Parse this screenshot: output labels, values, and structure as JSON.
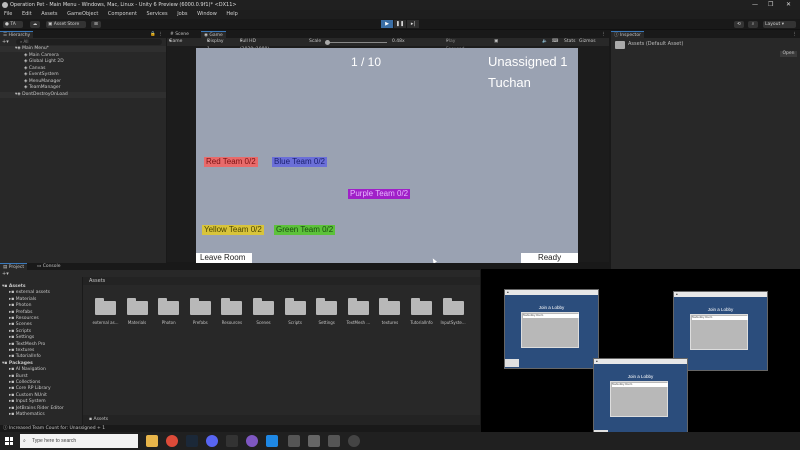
{
  "window": {
    "title": "Operation Pet - Main Menu - Windows, Mac, Linux - Unity 6 Preview (6000.0.9f1)* <DX11>",
    "controls": [
      "—",
      "❐",
      "✕"
    ]
  },
  "menu": [
    "File",
    "Edit",
    "Assets",
    "GameObject",
    "Component",
    "Services",
    "Jobs",
    "Window",
    "Help"
  ],
  "toolbar": {
    "account": "TA",
    "asset_store": "Asset Store",
    "layout": "Layout"
  },
  "hierarchy": {
    "tab": "Hierarchy",
    "search_placeholder": "All",
    "rows": [
      {
        "label": "Main Menu*",
        "indent": 0,
        "scene": true
      },
      {
        "label": "Main Camera",
        "indent": 1
      },
      {
        "label": "Global Light 2D",
        "indent": 1
      },
      {
        "label": "Canvas",
        "indent": 1
      },
      {
        "label": "EventSystem",
        "indent": 1
      },
      {
        "label": "MenuManager",
        "indent": 1
      },
      {
        "label": "TeamManager",
        "indent": 1
      },
      {
        "label": "DontDestroyOnLoad",
        "indent": 0,
        "scene": true
      }
    ]
  },
  "game": {
    "tabs": [
      "Scene",
      "Game"
    ],
    "display_mode": "Game",
    "display": "Display 1",
    "resolution": "Full HD (1920x1080)",
    "scale_label": "Scale",
    "scale_value": "0.48x",
    "play_mode": "Play Focused",
    "stats": "Stats",
    "gizmos": "Gizmos",
    "ui": {
      "counter": "1 / 10",
      "unassigned": "Unassigned 1",
      "player_name": "Tuchan",
      "teams": [
        {
          "label": "Red Team 0/2",
          "color": "#e86a6a",
          "text_color": "#7a1111"
        },
        {
          "label": "Blue Team 0/2",
          "color": "#6b6fd8",
          "text_color": "#1a1f6e"
        },
        {
          "label": "Purple Team 0/2",
          "color": "#a020c8",
          "text_color": "#e8b8ff"
        },
        {
          "label": "Yellow Team 0/2",
          "color": "#d8c43a",
          "text_color": "#4a4400"
        },
        {
          "label": "Green Team 0/2",
          "color": "#5cc23a",
          "text_color": "#1a4a10"
        }
      ],
      "leave_room": "Leave Room",
      "ready": "Ready"
    }
  },
  "inspector": {
    "tab": "Inspector",
    "title": "Assets (Default Asset)",
    "open_button": "Open"
  },
  "project": {
    "tabs": [
      "Project",
      "Console"
    ],
    "tree": [
      {
        "label": "Assets",
        "indent": 0,
        "bold": true
      },
      {
        "label": "external assets",
        "indent": 1
      },
      {
        "label": "Materials",
        "indent": 1
      },
      {
        "label": "Photon",
        "indent": 1
      },
      {
        "label": "Prefabs",
        "indent": 1
      },
      {
        "label": "Resources",
        "indent": 1
      },
      {
        "label": "Scenes",
        "indent": 1
      },
      {
        "label": "Scripts",
        "indent": 1
      },
      {
        "label": "Settings",
        "indent": 1
      },
      {
        "label": "TextMesh Pro",
        "indent": 1
      },
      {
        "label": "textures",
        "indent": 1
      },
      {
        "label": "TutorialInfo",
        "indent": 1
      },
      {
        "label": "Packages",
        "indent": 0,
        "bold": true
      },
      {
        "label": "AI Navigation",
        "indent": 1
      },
      {
        "label": "Burst",
        "indent": 1
      },
      {
        "label": "Collections",
        "indent": 1
      },
      {
        "label": "Core RP Library",
        "indent": 1
      },
      {
        "label": "Custom NUnit",
        "indent": 1
      },
      {
        "label": "Input System",
        "indent": 1
      },
      {
        "label": "JetBrains Rider Editor",
        "indent": 1
      },
      {
        "label": "Mathematics",
        "indent": 1
      }
    ],
    "breadcrumb": "Assets",
    "footer_path": "Assets",
    "folders": [
      "external as...",
      "Materials",
      "Photon",
      "Prefabs",
      "Resources",
      "Scenes",
      "Scripts",
      "Settings",
      "TextMesh ...",
      "textures",
      "TutorialInfo",
      "InputSyste..."
    ]
  },
  "status": {
    "message": "Increased Team Count for: Unassigned + 1"
  },
  "taskbar": {
    "search_placeholder": "Type here to search"
  },
  "lobby_windows": {
    "heading": "Join a Lobby",
    "input_placeholder": "TestLobby Room"
  }
}
